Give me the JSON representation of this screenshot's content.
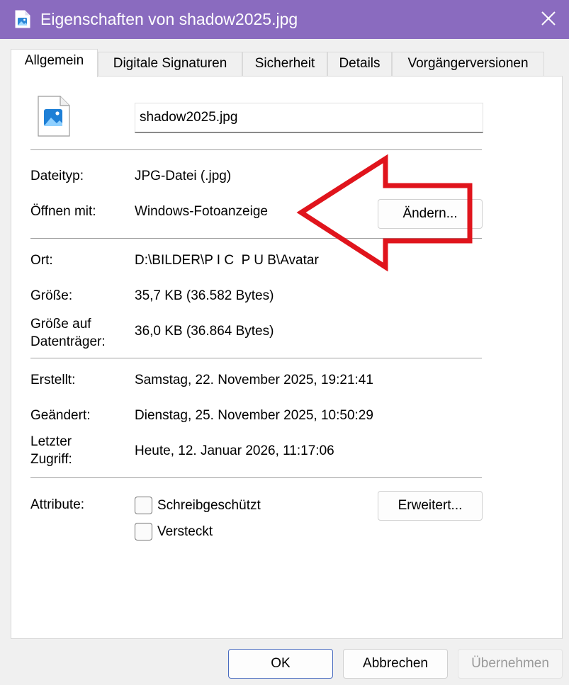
{
  "window": {
    "title": "Eigenschaften von shadow2025.jpg",
    "close_icon": "close-icon",
    "app_icon": "image-file-icon"
  },
  "tabs": [
    {
      "label": "Allgemein",
      "active": true
    },
    {
      "label": "Digitale Signaturen",
      "active": false
    },
    {
      "label": "Sicherheit",
      "active": false
    },
    {
      "label": "Details",
      "active": false
    },
    {
      "label": "Vorgängerversionen",
      "active": false
    }
  ],
  "general": {
    "filename": "shadow2025.jpg",
    "file_icon": "image-file-icon",
    "type_label": "Dateityp:",
    "type_value": "JPG-Datei (.jpg)",
    "open_with_label": "Öffnen mit:",
    "open_with_value": "Windows-Fotoanzeige",
    "change_button": "Ändern...",
    "location_label": "Ort:",
    "location_value": "D:\\BILDER\\P I C  P U B\\Avatar",
    "size_label": "Größe:",
    "size_value": "35,7 KB (36.582 Bytes)",
    "size_on_disk_label_1": "Größe auf",
    "size_on_disk_label_2": "Datenträger:",
    "size_on_disk_value": "36,0 KB (36.864 Bytes)",
    "created_label": "Erstellt:",
    "created_value": "Samstag, 22. November 2025, 19:21:41",
    "modified_label": "Geändert:",
    "modified_value": "Dienstag, 25. November 2025, 10:50:29",
    "accessed_label_1": "Letzter",
    "accessed_label_2": "Zugriff:",
    "accessed_value": "Heute, 12. Januar 2026, 11:17:06",
    "attributes_label": "Attribute:",
    "readonly_label": "Schreibgeschützt",
    "readonly_checked": false,
    "hidden_label": "Versteckt",
    "hidden_checked": false,
    "advanced_button": "Erweitert..."
  },
  "footer": {
    "ok": "OK",
    "cancel": "Abbrechen",
    "apply": "Übernehmen"
  },
  "annotation": {
    "arrow_color": "#e0141c",
    "arrow_icon": "red-arrow-left-annotation"
  },
  "colors": {
    "titlebar": "#8a6bbf",
    "primary_button_border": "#4a6cc0"
  }
}
